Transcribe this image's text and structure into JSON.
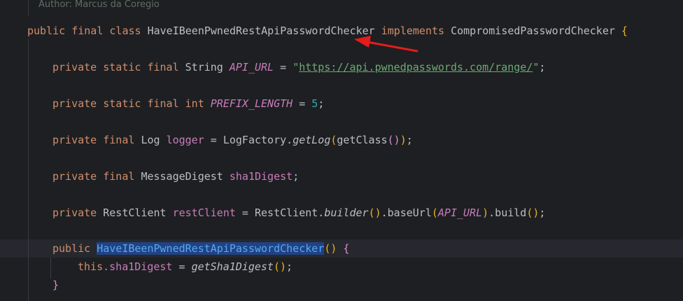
{
  "author": "Author: Marcus da Coregio",
  "class_line": {
    "kw_public": "public",
    "kw_final": "final",
    "kw_class": "class",
    "class_name": "HaveIBeenPwnedRestApiPasswordChecker",
    "kw_implements": "implements",
    "interface": "CompromisedPasswordChecker",
    "open_brace": "{"
  },
  "api_url_line": {
    "kw": "private static final",
    "type": "String",
    "name": "API_URL",
    "eq": " = ",
    "q1": "\"",
    "url": "https://api.pwnedpasswords.com/range/",
    "q2": "\"",
    "semi": ";"
  },
  "prefix_line": {
    "kw": "private static final int",
    "name": "PREFIX_LENGTH",
    "eq": " = ",
    "value": "5",
    "semi": ";"
  },
  "logger_line": {
    "kw": "private final",
    "type": "Log",
    "name": "logger",
    "eq": " = ",
    "factory": "LogFactory.",
    "method": "getLog",
    "p1o": "(",
    "call": "getClass",
    "p2": "()",
    "p1c": ")",
    "semi": ";"
  },
  "digest_line": {
    "kw": "private final",
    "type": "MessageDigest",
    "name": "sha1Digest",
    "semi": ";"
  },
  "rest_line": {
    "kw": "private",
    "type": "RestClient",
    "name": "restClient",
    "eq": " = ",
    "owner": "RestClient.",
    "builder": "builder",
    "p1": "()",
    "base": ".baseUrl",
    "p2o": "(",
    "arg": "API_URL",
    "p2c": ")",
    "build": ".build",
    "p3": "()",
    "semi": ";"
  },
  "ctor_line": {
    "kw": "public",
    "name": "HaveIBeenPwnedRestApiPasswordChecker",
    "parens": "()",
    "open": "{"
  },
  "body_line": {
    "this": "this",
    "field": ".sha1Digest",
    "eq": " = ",
    "method": "getSha1Digest",
    "parens": "()",
    "semi": ";"
  },
  "close_line": {
    "close": "}"
  },
  "colors": {
    "background": "#1e1f22",
    "keyword": "#cf8e6d",
    "field": "#c77dbb",
    "string": "#6aab73",
    "number": "#2aacb8",
    "arrow": "#e41c1c"
  }
}
